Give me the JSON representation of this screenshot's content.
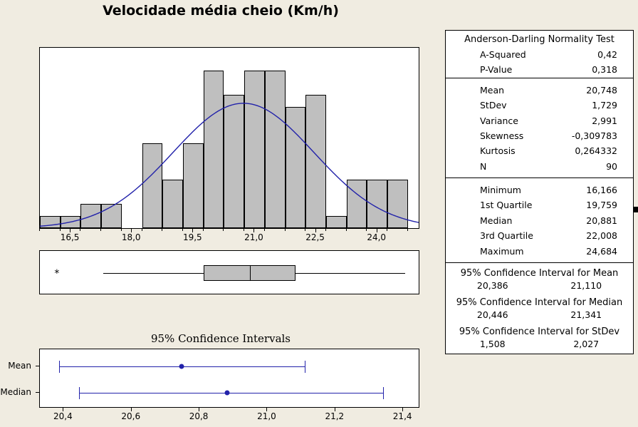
{
  "title": "Velocidade média cheio (Km/h)",
  "histogram": {
    "x_ticks": [
      "16,5",
      "18,0",
      "19,5",
      "21,0",
      "22,5",
      "24,0"
    ],
    "x_tick_values": [
      16.5,
      18.0,
      19.5,
      21.0,
      22.5,
      24.0
    ]
  },
  "boxplot": {
    "outlier_marker": "*"
  },
  "ci_plot": {
    "title": "95% Confidence Intervals",
    "rows": [
      "Mean",
      "Median"
    ],
    "x_ticks": [
      "20,4",
      "20,6",
      "20,8",
      "21,0",
      "21,2",
      "21,4"
    ],
    "x_tick_values": [
      20.4,
      20.6,
      20.8,
      21.0,
      21.2,
      21.4
    ]
  },
  "stats": {
    "ad_heading": "Anderson-Darling Normality Test",
    "ad_rows": [
      {
        "label": "A-Squared",
        "value": "0,42"
      },
      {
        "label": "P-Value",
        "value": "0,318"
      }
    ],
    "moment_rows": [
      {
        "label": "Mean",
        "value": "20,748"
      },
      {
        "label": "StDev",
        "value": "1,729"
      },
      {
        "label": "Variance",
        "value": "2,991"
      },
      {
        "label": "Skewness",
        "value": "-0,309783"
      },
      {
        "label": "Kurtosis",
        "value": "0,264332"
      },
      {
        "label": "N",
        "value": "90"
      }
    ],
    "quantile_rows": [
      {
        "label": "Minimum",
        "value": "16,166"
      },
      {
        "label": "1st Quartile",
        "value": "19,759"
      },
      {
        "label": "Median",
        "value": "20,881"
      },
      {
        "label": "3rd Quartile",
        "value": "22,008"
      },
      {
        "label": "Maximum",
        "value": "24,684"
      }
    ],
    "ci_mean": {
      "heading": "95% Confidence Interval for Mean",
      "lower": "20,386",
      "upper": "21,110"
    },
    "ci_median": {
      "heading": "95% Confidence Interval for Median",
      "lower": "20,446",
      "upper": "21,341"
    },
    "ci_stdev": {
      "heading": "95% Confidence Interval for StDev",
      "lower": "1,508",
      "upper": "2,027"
    }
  },
  "colors": {
    "background": "#f0ece1",
    "bar_fill": "#bfbfbf",
    "bar_edge": "#000000",
    "curve": "#2222aa",
    "ci_marker": "#2222aa",
    "panel": "#ffffff"
  },
  "chart_data": {
    "type": "histogram",
    "title": "Velocidade média cheio (Km/h)",
    "xlabel": "",
    "ylabel": "",
    "xlim": [
      15.75,
      25.05
    ],
    "ylim": [
      0,
      15
    ],
    "grid": false,
    "legend": "none",
    "bin_width": 0.5,
    "bin_edges": [
      15.75,
      16.25,
      16.75,
      17.25,
      17.75,
      18.25,
      18.75,
      19.25,
      19.75,
      20.25,
      20.75,
      21.25,
      21.75,
      22.25,
      22.75,
      23.25,
      23.75,
      24.25,
      24.75
    ],
    "bin_centers": [
      16.0,
      16.5,
      17.0,
      17.5,
      18.0,
      18.5,
      19.0,
      19.5,
      20.0,
      20.5,
      21.0,
      21.5,
      22.0,
      22.5,
      23.0,
      23.5,
      24.0,
      24.5
    ],
    "counts": [
      1,
      1,
      2,
      2,
      0,
      7,
      4,
      7,
      13,
      11,
      13,
      13,
      10,
      11,
      1,
      4,
      4,
      4
    ],
    "normal_curve": {
      "shown": true,
      "mean": 20.748,
      "stdev": 1.729,
      "color": "#2222aa"
    },
    "boxplot": {
      "min_whisker": 17.3,
      "q1": 19.759,
      "median": 20.881,
      "q3": 22.008,
      "max_whisker": 24.684,
      "outliers": [
        16.166
      ]
    },
    "confidence_intervals": {
      "xlim": [
        20.33,
        21.45
      ],
      "series": [
        {
          "name": "Mean",
          "point": 20.748,
          "lower": 20.386,
          "upper": 21.11
        },
        {
          "name": "Median",
          "point": 20.881,
          "lower": 20.446,
          "upper": 21.341
        }
      ]
    },
    "summary_statistics": {
      "A-Squared": 0.42,
      "P-Value": 0.318,
      "Mean": 20.748,
      "StDev": 1.729,
      "Variance": 2.991,
      "Skewness": -0.309783,
      "Kurtosis": 0.264332,
      "N": 90,
      "Minimum": 16.166,
      "1st Quartile": 19.759,
      "Median": 20.881,
      "3rd Quartile": 22.008,
      "Maximum": 24.684
    }
  }
}
